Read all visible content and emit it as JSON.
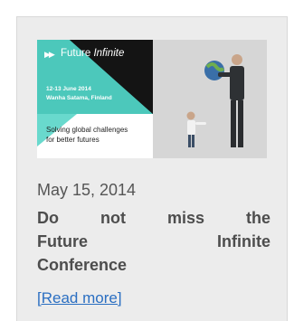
{
  "banner": {
    "title_plain": "Future",
    "title_italic": "Infinite",
    "arrows": "▶▶",
    "event_date": "12-13 June 2014",
    "event_place": "Wanha Satama, Finland",
    "slogan_line1": "Solving global challenges",
    "slogan_line2": "for better futures",
    "colors": {
      "dark": "#141414",
      "teal": "#4fd2c4",
      "photo_bg": "#d6d6d6",
      "suit": "#2e3134"
    }
  },
  "post": {
    "date": "May 15, 2014",
    "headline_line1": [
      "Do",
      "not",
      "miss",
      "the"
    ],
    "headline_line2": [
      "Future",
      "Infinite"
    ],
    "headline_line3": "Conference",
    "read_more": "[Read more]"
  },
  "colors": {
    "card_bg": "#ececec",
    "link": "#2b6fc2",
    "text": "#4d4d4d"
  }
}
